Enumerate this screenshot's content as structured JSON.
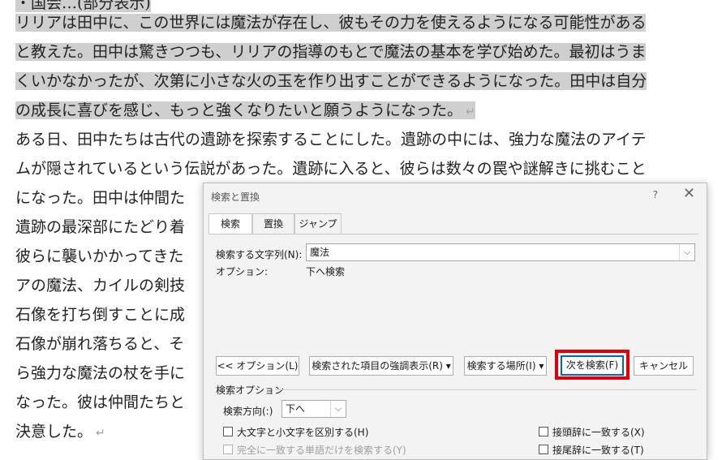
{
  "document": {
    "partial_top": "・国会…(部分表示)",
    "selected_lines": [
      "リリアは田中に、この世界には魔法が存在し、彼もその力を使えるようになる可能性がある",
      "と教えた。田中は驚きつつも、リリアの指導のもとで魔法の基本を学び始めた。最初はうま",
      "くいかなかったが、次第に小さな火の玉を作り出すことができるようになった。田中は自分",
      "の成長に喜びを感じ、もっと強くなりたいと願うようになった。"
    ],
    "lines": [
      "ある日、田中たちは古代の遺跡を探索することにした。遺跡の中には、強力な魔法のアイテ",
      "ムが隠されているという伝説があった。遺跡に入ると、彼らは数々の罠や謎解きに挑むこと",
      "になった。田中は仲間た",
      "遺跡の最深部にたどり着",
      "彼らに襲いかかってきた",
      "アの魔法、カイルの剣技",
      "石像を打ち倒すことに成",
      "石像が崩れ落ちると、そ",
      "ら強力な魔法の杖を手に",
      "なった。彼は仲間たちと",
      "決意した。"
    ],
    "paragraph_mark": "↵"
  },
  "dialog": {
    "title": "検索と置換",
    "help": "?",
    "close": "✕",
    "tabs": [
      "検索",
      "置換",
      "ジャンプ"
    ],
    "search_label": "検索する文字列(N):",
    "search_value": "魔法",
    "options_label": "オプション:",
    "options_value": "下へ検索",
    "buttons": {
      "less": "<< オプション(L)",
      "highlight": "検索された項目の強調表示(R) ▾",
      "find_in": "検索する場所(I) ▾",
      "find_next": "次を検索(F)",
      "cancel": "キャンセル"
    },
    "search_options_title": "検索オプション",
    "direction_label": "検索方向(:)",
    "direction_value": "下へ",
    "checkboxes": {
      "match_case": "大文字と小文字を区別する(H)",
      "whole_word": "完全に一致する単語だけを検索する(Y)",
      "prefix": "接頭辞に一致する(X)",
      "suffix": "接尾辞に一致する(T)"
    }
  }
}
